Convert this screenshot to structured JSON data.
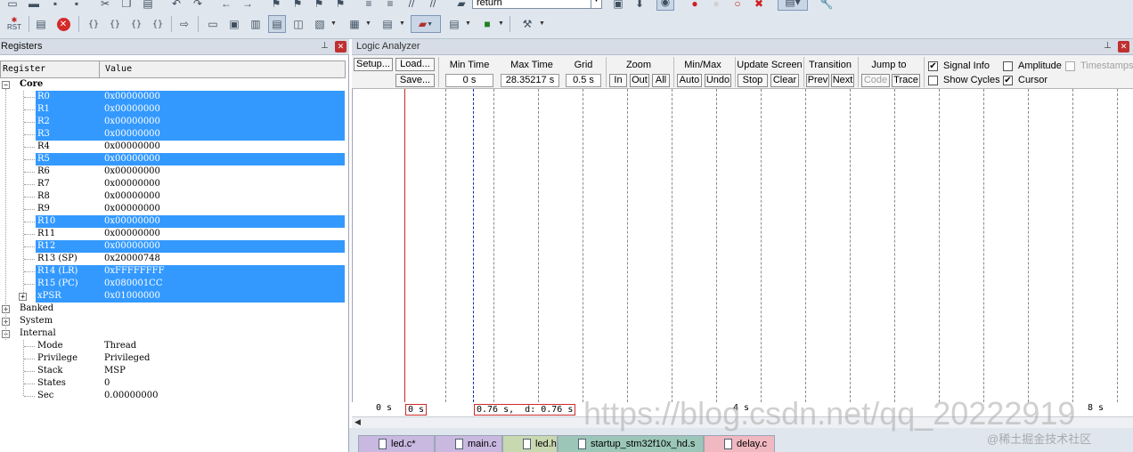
{
  "toolbar": {
    "rst_label": "RST",
    "combo_value": "return"
  },
  "registers": {
    "title": "Registers",
    "col_register": "Register",
    "col_value": "Value",
    "core_label": "Core",
    "core_rows": [
      {
        "name": "R0",
        "value": "0x00000000",
        "selected": true
      },
      {
        "name": "R1",
        "value": "0x00000000",
        "selected": true
      },
      {
        "name": "R2",
        "value": "0x00000000",
        "selected": true
      },
      {
        "name": "R3",
        "value": "0x00000000",
        "selected": true
      },
      {
        "name": "R4",
        "value": "0x00000000",
        "selected": false
      },
      {
        "name": "R5",
        "value": "0x00000000",
        "selected": true
      },
      {
        "name": "R6",
        "value": "0x00000000",
        "selected": false
      },
      {
        "name": "R7",
        "value": "0x00000000",
        "selected": false
      },
      {
        "name": "R8",
        "value": "0x00000000",
        "selected": false
      },
      {
        "name": "R9",
        "value": "0x00000000",
        "selected": false
      },
      {
        "name": "R10",
        "value": "0x00000000",
        "selected": true
      },
      {
        "name": "R11",
        "value": "0x00000000",
        "selected": false
      },
      {
        "name": "R12",
        "value": "0x00000000",
        "selected": true
      },
      {
        "name": "R13 (SP)",
        "value": "0x20000748",
        "selected": false
      },
      {
        "name": "R14 (LR)",
        "value": "0xFFFFFFFF",
        "selected": true
      },
      {
        "name": "R15 (PC)",
        "value": "0x080001CC",
        "selected": true
      },
      {
        "name": "xPSR",
        "value": "0x01000000",
        "selected": true
      }
    ],
    "groups": [
      "Banked",
      "System",
      "Internal"
    ],
    "internal_rows": [
      {
        "name": "Mode",
        "value": "Thread"
      },
      {
        "name": "Privilege",
        "value": "Privileged"
      },
      {
        "name": "Stack",
        "value": "MSP"
      },
      {
        "name": "States",
        "value": "0"
      },
      {
        "name": "Sec",
        "value": "0.00000000"
      }
    ]
  },
  "logic_analyzer": {
    "title": "Logic Analyzer",
    "setup": "Setup...",
    "load": "Load...",
    "save": "Save...",
    "min_time_label": "Min Time",
    "min_time_value": "0 s",
    "max_time_label": "Max Time",
    "max_time_value": "28.35217 s",
    "grid_label": "Grid",
    "grid_value": "0.5 s",
    "zoom_label": "Zoom",
    "zoom_in": "In",
    "zoom_out": "Out",
    "zoom_all": "All",
    "minmax_label": "Min/Max",
    "minmax_auto": "Auto",
    "minmax_undo": "Undo",
    "update_label": "Update Screen",
    "update_stop": "Stop",
    "update_clear": "Clear",
    "transition_label": "Transition",
    "transition_prev": "Prev",
    "transition_next": "Next",
    "jump_label": "Jump to",
    "jump_code": "Code",
    "jump_trace": "Trace",
    "signal_info": "Signal Info",
    "show_cycles": "Show Cycles",
    "amplitude": "Amplitude",
    "cursor": "Cursor",
    "timestamps": "Timestamps",
    "signal_info_checked": true,
    "show_cycles_checked": false,
    "amplitude_checked": false,
    "cursor_checked": true,
    "timestamps_checked": false,
    "axis_left": "0 s",
    "axis_box1": "0 s",
    "axis_box2": "0.76 s,  d: 0.76 s",
    "axis_mid": "4 s",
    "axis_right": "8 s"
  },
  "tabs": [
    {
      "label": "led.c*",
      "color": "#c9b8e0"
    },
    {
      "label": "main.c",
      "color": "#c9b8e0"
    },
    {
      "label": "led.h",
      "color": "#c8d8b0"
    },
    {
      "label": "startup_stm32f10x_hd.s",
      "color": "#9cc7b8"
    },
    {
      "label": "delay.c",
      "color": "#f0b8c0"
    }
  ],
  "watermark": "https://blog.csdn.net/qq_20222919",
  "watermark2": "@稀土掘金技术社区"
}
